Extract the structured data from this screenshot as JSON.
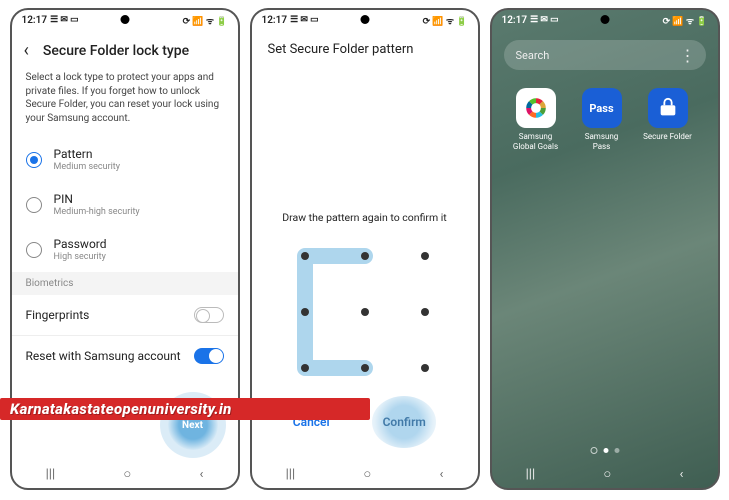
{
  "status": {
    "time": "12:17",
    "icons": "▧ ✉ ◧ ⟳"
  },
  "phone1": {
    "title": "Secure Folder lock type",
    "desc": "Select a lock type to protect your apps and private files. If you forget how to unlock Secure Folder, you can reset your lock using your Samsung account.",
    "options": [
      {
        "label": "Pattern",
        "sub": "Medium security",
        "selected": true
      },
      {
        "label": "PIN",
        "sub": "Medium-high security",
        "selected": false
      },
      {
        "label": "Password",
        "sub": "High security",
        "selected": false
      }
    ],
    "biometrics_header": "Biometrics",
    "fingerprints_label": "Fingerprints",
    "reset_label": "Reset with Samsung account",
    "next_label": "Next"
  },
  "phone2": {
    "title": "Set Secure Folder pattern",
    "instruction": "Draw the pattern again to confirm it",
    "cancel_label": "Cancel",
    "confirm_label": "Confirm"
  },
  "phone3": {
    "search_placeholder": "Search",
    "apps": [
      {
        "label": "Samsung Global Goals",
        "icon": "goals"
      },
      {
        "label": "Samsung Pass",
        "icon": "pass",
        "text": "Pass"
      },
      {
        "label": "Secure Folder",
        "icon": "folder"
      }
    ]
  },
  "nav": {
    "recent": "|||",
    "home": "○",
    "back": "‹"
  },
  "watermark": "Karnatakastateopenuniversity.in"
}
